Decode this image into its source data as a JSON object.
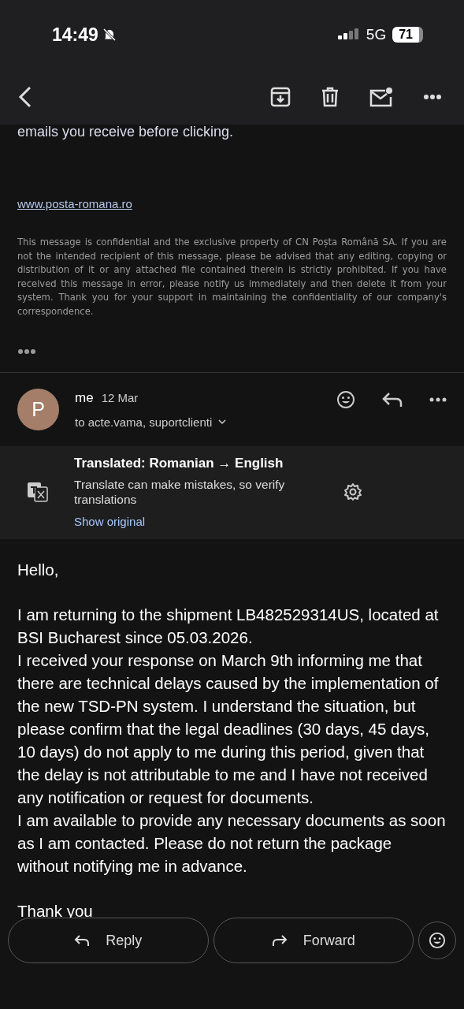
{
  "status_bar": {
    "time": "14:49",
    "network": "5G",
    "battery": "71"
  },
  "previous_message": {
    "tail": "emails you receive before clicking.",
    "link": "www.posta-romana.ro",
    "disclaimer": "This message is confidential and the exclusive property of CN Poșta Română SA. If you are not the intended recipient of this message, please be advised that any editing, copying or distribution of it or any attached file contained therein is strictly prohibited. If you have received this message in error, please notify us immediately and then delete it from your system. Thank you for your support in maintaining the confidentiality of our company's correspondence."
  },
  "message": {
    "avatar": "P",
    "sender": "me",
    "date": "12 Mar",
    "recipients": "to acte.vama, suportclienti"
  },
  "translation": {
    "title": "Translated: Romanian → English",
    "note": "Translate can make mistakes, so verify translations",
    "action": "Show original"
  },
  "body": {
    "greeting": "Hello,",
    "lines": [
      "I am returning to the shipment LB482529314US, located at BSI Bucharest since 05.03.2026.",
      "I received your response on March 9th informing me that there are technical delays caused by the implementation of the new TSD-PN system. I understand the situation, but please confirm that the legal deadlines (30 days, 45 days, 10 days) do not apply to me during this period, given that the delay is not attributable to me and I have not received any notification or request for documents.",
      "I am available to provide any necessary documents as soon as I am contacted. Please do not return the package without notifying me in advance."
    ],
    "closing": "Thank you"
  },
  "actions": [
    {
      "label": "Reply",
      "kind": "reply"
    },
    {
      "label": "Forward",
      "kind": "forward"
    }
  ]
}
